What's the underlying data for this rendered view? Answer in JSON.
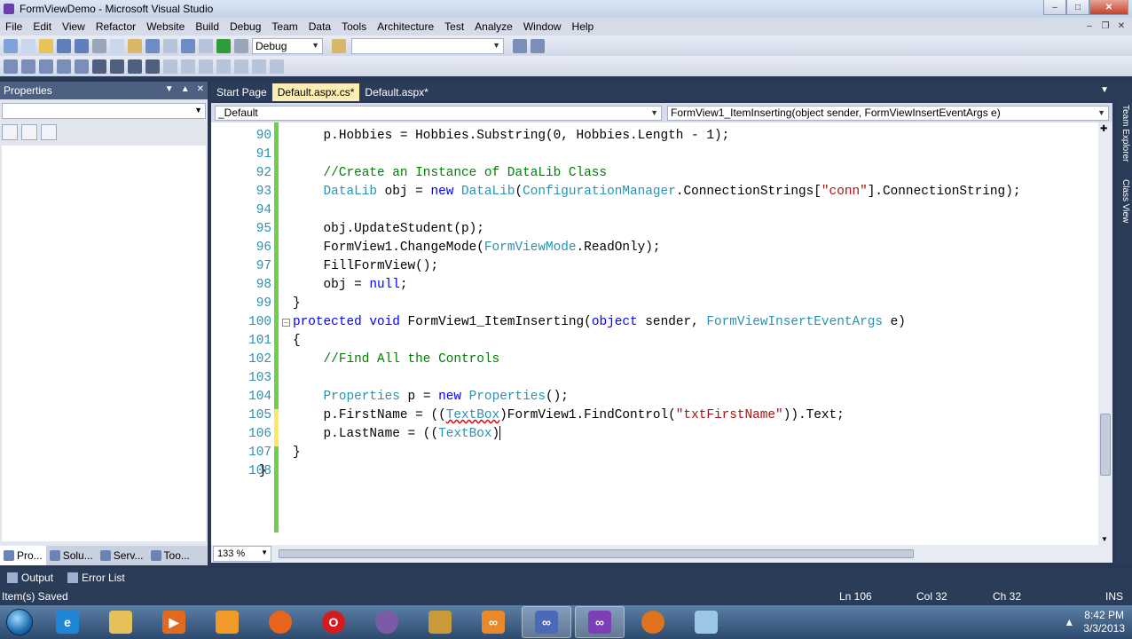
{
  "window": {
    "title": "FormViewDemo - Microsoft Visual Studio"
  },
  "menu": [
    "File",
    "Edit",
    "View",
    "Refactor",
    "Website",
    "Build",
    "Debug",
    "Team",
    "Data",
    "Tools",
    "Architecture",
    "Test",
    "Analyze",
    "Window",
    "Help"
  ],
  "toolbar": {
    "config_value": "Debug",
    "platform_value": ""
  },
  "properties": {
    "title": "Properties",
    "tabs": [
      "Pro...",
      "Solu...",
      "Serv...",
      "Too..."
    ]
  },
  "doc_tabs": [
    "Start Page",
    "Default.aspx.cs*",
    "Default.aspx*"
  ],
  "nav": {
    "class_combo": "_Default",
    "member_combo": "FormView1_ItemInserting(object sender, FormViewInsertEventArgs e)"
  },
  "code": {
    "line_numbers": [
      "90",
      "91",
      "92",
      "93",
      "94",
      "95",
      "96",
      "97",
      "98",
      "99",
      "100",
      "101",
      "102",
      "103",
      "104",
      "105",
      "106",
      "107",
      "108"
    ]
  },
  "zoom": "133 %",
  "right_strip": [
    "Team Explorer",
    "Class View"
  ],
  "output_tabs": [
    "Output",
    "Error List"
  ],
  "status": {
    "message": "Item(s) Saved",
    "line": "Ln 106",
    "col": "Col 32",
    "ch": "Ch 32",
    "mode": "INS"
  },
  "clock": {
    "time": "8:42 PM",
    "date": "3/3/2013"
  },
  "colors": {
    "keyword": "#0000ff",
    "type": "#2b91af",
    "comment": "#008000",
    "string": "#a31515",
    "chrome": "#2b3c59"
  }
}
